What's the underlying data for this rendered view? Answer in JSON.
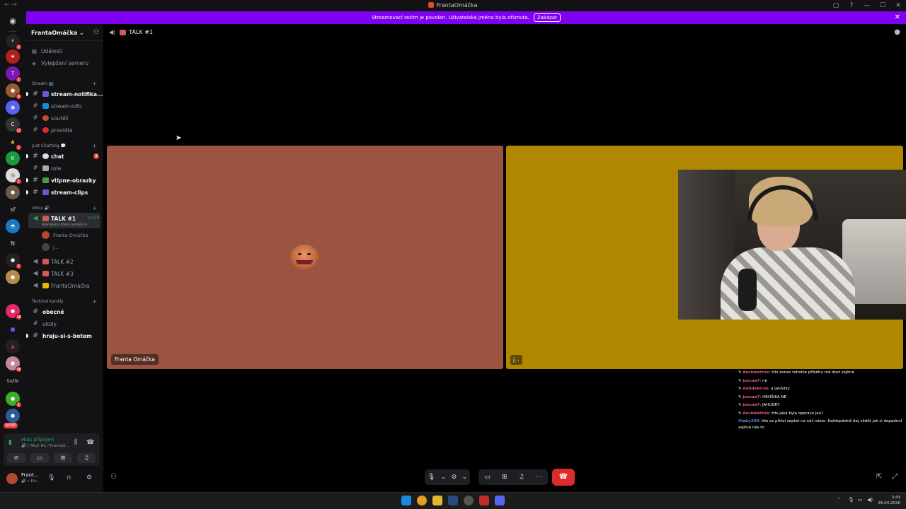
{
  "window": {
    "title": "FrantaOmáčka",
    "nav": "← →",
    "controls": [
      "▢",
      "?",
      "—",
      "☐",
      "✕"
    ]
  },
  "banner": {
    "text": "Streamovací režim je povolen. Uživatelská jména byla ořiznuta.",
    "button": "Zakázat",
    "close": "✕"
  },
  "rail": {
    "home_icon": "discord-icon",
    "text_servers": [
      "sf",
      "N",
      "SužIV"
    ],
    "new_badge": "NOVÉ",
    "badges": [
      "2",
      "1",
      "6",
      "1",
      "23",
      "1",
      "1",
      "1",
      "18",
      "96",
      "1"
    ]
  },
  "server": {
    "name": "FrantaOmáčka",
    "chevron": "⌄",
    "events": "Události",
    "boost": "Vylepšení serveru"
  },
  "categories": {
    "stream": "Stream 📺",
    "just_chatting": "Just Chatting 💬",
    "voice": "Voice 🔊",
    "text": "Textové kanály"
  },
  "channels": {
    "stream_notif": "stream-notifika...",
    "stream_info": "stream-info",
    "soutez": "soutěž",
    "pravidla": "pravidla",
    "chat": "chat",
    "chat_badge": "1",
    "role": "role",
    "vtipne": "vtipne-obrazky",
    "clips": "stream-clips",
    "talk1": "TALK #1",
    "talk1_time": "12:09",
    "talk1_status": "Nastavení stavu kanálu ✏",
    "talk2": "TALK #2",
    "talk3": "TALK #3",
    "franta_voice": "FrantaOmáčka",
    "obecne": "obecné",
    "ukoly": "ukoly",
    "hraju": "hraju-si-s-botem"
  },
  "members": [
    "Franta Omáčka",
    "j..."
  ],
  "voice_panel": {
    "status": "Hlas připojen",
    "sub": "🔊 | TALK #1 / FrantaO..."
  },
  "user_panel": {
    "name": "Frant...",
    "status": "🔊 • Kic..."
  },
  "main": {
    "channel": "TALK #1",
    "tile1_name": "Franta Omáčka",
    "tile2_name": "j..."
  },
  "chat_overlay": [
    {
      "user": "davidektrek",
      "color": "#e05a7a",
      "text": ": ttts konec tohohle příběhu mě dost zajímá"
    },
    {
      "user": "jancaa7",
      "color": "#e05a7a",
      "text": ": ne"
    },
    {
      "user": "datidektrek",
      "color": "#e05a7a",
      "text": ": a jahůdky"
    },
    {
      "user": "jancaa7",
      "color": "#e05a7a",
      "text": ": HROŠIKA NE"
    },
    {
      "user": "jancaa7",
      "color": "#e05a7a",
      "text": ": JAHUDKY"
    },
    {
      "user": "davidektrek",
      "color": "#e05a7a",
      "text": ": ttts jaká byla operace jeu?"
    },
    {
      "user": "Staby200",
      "color": "#5a8ae0",
      "text": ": ttts se přišel zeptat na náš názor. Každopádně dej vědět jak si dopadnul zajímá nás to"
    }
  ],
  "taskbar": {
    "time": "3:43",
    "date": "26.04.2026"
  },
  "colors": {
    "accent": "#8000f0",
    "connected": "#23a55a",
    "hangup": "#da2c2c",
    "tile1": "#9a5440",
    "tile2": "#b08700"
  }
}
